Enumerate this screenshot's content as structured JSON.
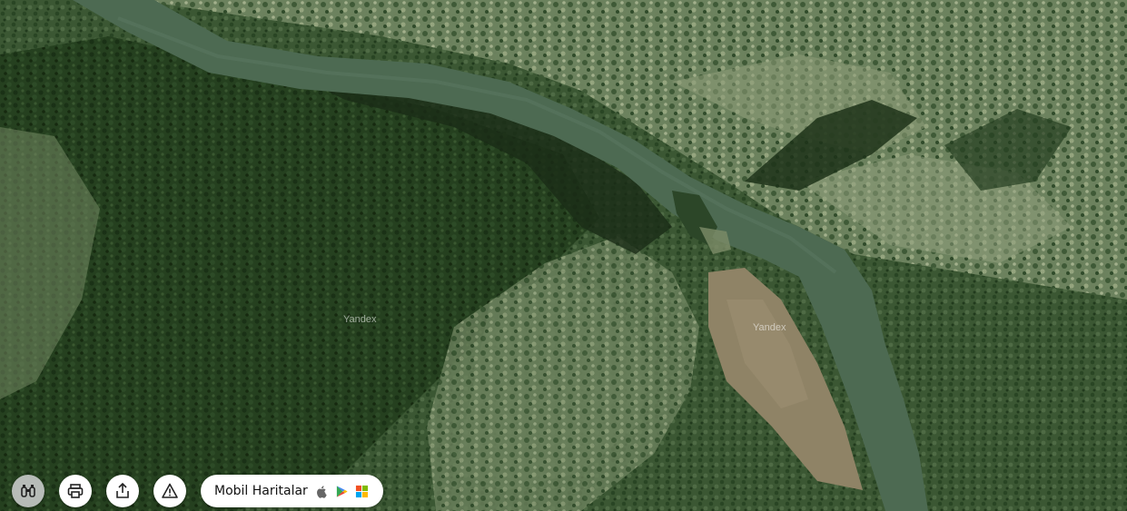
{
  "map": {
    "watermarks": [
      "Yandex",
      "Yandex"
    ]
  },
  "controls": {
    "panorama_icon": "binoculars-icon",
    "print_icon": "printer-icon",
    "share_icon": "share-icon",
    "report_icon": "warning-icon"
  },
  "mobile": {
    "label": "Mobil Haritalar",
    "stores": [
      "apple-icon",
      "google-play-icon",
      "windows-icon"
    ]
  },
  "colors": {
    "river": "#4d6a52",
    "forest_dark": "#243d22",
    "meadow": "#8a9a72",
    "clearing": "#8c7f64"
  }
}
